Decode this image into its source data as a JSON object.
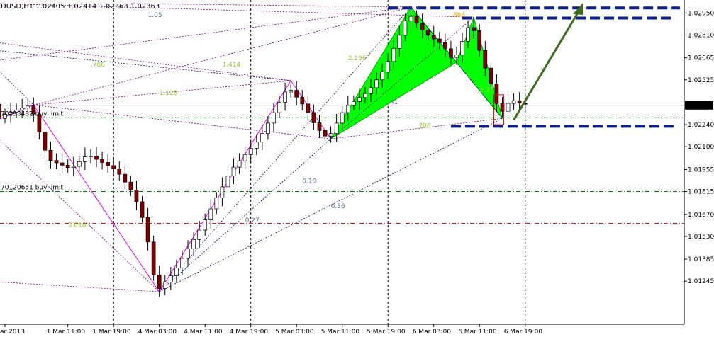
{
  "chart_data": {
    "type": "candlestick",
    "title": "DUSD,H1  1.02405 1.02414 1.02363 1.02363",
    "symbol": "DUSD,H1",
    "ohlc_header": [
      "1.02405",
      "1.02414",
      "1.02363",
      "1.02363"
    ],
    "current_price": 1.02363,
    "current_price_label": "1.02363",
    "ylim": [
      1.0103,
      1.0301
    ],
    "y_ticks": [
      {
        "value": 1.0295,
        "label": "1.02950"
      },
      {
        "value": 1.0281,
        "label": "1.02810"
      },
      {
        "value": 1.02665,
        "label": "1.02665"
      },
      {
        "value": 1.02525,
        "label": "1.02525"
      },
      {
        "value": 1.0224,
        "label": "1.02240"
      },
      {
        "value": 1.021,
        "label": "1.02100"
      },
      {
        "value": 1.01955,
        "label": "1.01955"
      },
      {
        "value": 1.01815,
        "label": "1.01815"
      },
      {
        "value": 1.0167,
        "label": "1.01670"
      },
      {
        "value": 1.0153,
        "label": "1.01530"
      },
      {
        "value": 1.01385,
        "label": "1.01385"
      },
      {
        "value": 1.01245,
        "label": "1.01245"
      }
    ],
    "x_ticks": [
      {
        "bar": 0,
        "label": "ar 2013"
      },
      {
        "bar": 11,
        "label": "1 Mar 11:00"
      },
      {
        "bar": 19,
        "label": "1 Mar 19:00"
      },
      {
        "bar": 27,
        "label": "4 Mar 03:00"
      },
      {
        "bar": 35,
        "label": "4 Mar 11:00"
      },
      {
        "bar": 43,
        "label": "4 Mar 19:00"
      },
      {
        "bar": 51,
        "label": "5 Mar 03:00"
      },
      {
        "bar": 59,
        "label": "5 Mar 11:00"
      },
      {
        "bar": 67,
        "label": "5 Mar 19:00"
      },
      {
        "bar": 75,
        "label": "6 Mar 03:00"
      },
      {
        "bar": 83,
        "label": "6 Mar 11:00"
      },
      {
        "bar": 91,
        "label": "6 Mar 19:00"
      }
    ],
    "day_separators": [
      19,
      43,
      67,
      91
    ],
    "price_lines": [
      {
        "value": 1.02284,
        "label": "70293482 buy limit",
        "color": "#008000",
        "style": "dashdot"
      },
      {
        "value": 1.01815,
        "label": "70120651 buy limit",
        "color": "#008000",
        "style": "dashdot"
      },
      {
        "value": 1.01612,
        "label": "",
        "color": "#cc0000",
        "style": "dashdot"
      }
    ],
    "harmonic_patterns": [
      {
        "points": [
          [
            57,
            1.0215
          ],
          [
            71,
            1.02988
          ],
          [
            79,
            1.02637
          ]
        ],
        "fill": "#00ff00"
      },
      {
        "points": [
          [
            79,
            1.02637
          ],
          [
            82,
            1.02923
          ],
          [
            87,
            1.0228
          ]
        ],
        "fill": "#00ff00"
      }
    ],
    "zigzag": [
      [
        -2,
        1.0226
      ],
      [
        5,
        1.02365
      ],
      [
        27,
        1.01178
      ],
      [
        50,
        1.0252
      ],
      [
        57,
        1.0215
      ]
    ],
    "fib_labels": [
      {
        "text": "1.05",
        "bar": 25,
        "price": 1.02925,
        "color": "#5a6f8f"
      },
      {
        "text": ".786",
        "bar": 15,
        "price": 1.0261,
        "color": "#99cc33"
      },
      {
        "text": "1.414",
        "bar": 38,
        "price": 1.0261,
        "color": "#99cc33"
      },
      {
        "text": "1.128",
        "bar": 27,
        "price": 1.0243,
        "color": "#99cc33"
      },
      {
        "text": "2.236",
        "bar": 60,
        "price": 1.0265,
        "color": "#99cc33"
      },
      {
        "text": ".886",
        "bar": 78,
        "price": 1.02925,
        "color": "#e0a000"
      },
      {
        "text": "2.236",
        "bar": 83,
        "price": 1.0245,
        "color": "#99cc33"
      },
      {
        "text": ".41",
        "bar": 67,
        "price": 1.0237,
        "color": "#5a6f8f"
      },
      {
        "text": ".786",
        "bar": 72,
        "price": 1.0222,
        "color": "#99cc33"
      },
      {
        "text": "0.19",
        "bar": 52,
        "price": 1.0187,
        "color": "#5a6f8f"
      },
      {
        "text": "0.36",
        "bar": 57,
        "price": 1.0171,
        "color": "#5a6f8f"
      },
      {
        "text": "0.27",
        "bar": 42,
        "price": 1.0162,
        "color": "#5a6f8f"
      },
      {
        "text": "3.618",
        "bar": 11,
        "price": 1.0159,
        "color": "#99cc33"
      }
    ]
  }
}
